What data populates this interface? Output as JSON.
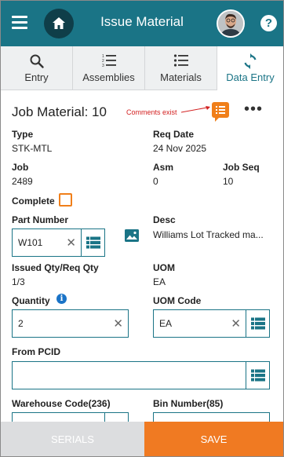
{
  "header": {
    "title": "Issue Material",
    "help_label": "?"
  },
  "tabs": [
    {
      "label": "Entry",
      "icon": "search-icon"
    },
    {
      "label": "Assemblies",
      "icon": "numbered-list-icon"
    },
    {
      "label": "Materials",
      "icon": "list-icon"
    },
    {
      "label": "Data Entry",
      "icon": "sync-icon",
      "active": true
    }
  ],
  "job": {
    "title": "Job Material: 10",
    "comments_note": "Comments exist",
    "more_label": "•••"
  },
  "fields": {
    "type_label": "Type",
    "type_value": "STK-MTL",
    "req_date_label": "Req Date",
    "req_date_value": "24 Nov 2025",
    "job_label": "Job",
    "job_value": "2489",
    "asm_label": "Asm",
    "asm_value": "0",
    "job_seq_label": "Job Seq",
    "job_seq_value": "10",
    "complete_label": "Complete",
    "part_number_label": "Part Number",
    "part_number_value": "W101",
    "desc_label": "Desc",
    "desc_value": "Williams Lot Tracked ma...",
    "issued_req_label": "Issued Qty/Req Qty",
    "issued_req_value": "1/3",
    "uom_label": "UOM",
    "uom_value": "EA",
    "quantity_label": "Quantity",
    "quantity_value": "2",
    "uom_code_label": "UOM Code",
    "uom_code_value": "EA",
    "from_pcid_label": "From PCID",
    "from_pcid_value": "",
    "warehouse_label": "Warehouse Code(236)",
    "bin_label": "Bin Number(85)"
  },
  "footer": {
    "serials_label": "SERIALS",
    "save_label": "SAVE"
  },
  "colors": {
    "header_bg": "#1a7486",
    "accent_orange": "#f07a22",
    "comment_note": "#d32020"
  }
}
